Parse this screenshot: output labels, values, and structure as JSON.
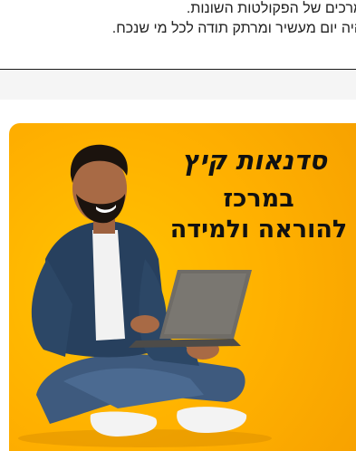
{
  "article": {
    "line1": "מרכים של הפקולטות השונות.",
    "line2": "היה יום מעשיר ומרתק תודה לכל מי שנכח."
  },
  "banner": {
    "title_line1": "סדנאות קיץ",
    "title_line2": "במרכז",
    "title_line3": "להוראה ולמידה"
  },
  "colors": {
    "banner_bg": "#ffb300",
    "title_text": "#111111",
    "shirt": "#27405e",
    "jeans": "#3e5a7e",
    "laptop": "#6f6c67"
  }
}
